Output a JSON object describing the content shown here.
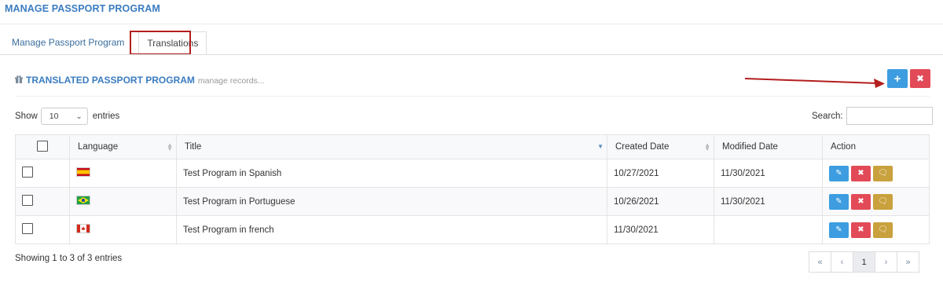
{
  "page_title": "MANAGE PASSPORT PROGRAM",
  "tabs": [
    {
      "label": "Manage Passport Program",
      "active": false
    },
    {
      "label": "Translations",
      "active": true
    }
  ],
  "section": {
    "icon": "gift-icon",
    "title": "TRANSLATED PASSPORT PROGRAM",
    "subtitle": "manage records..."
  },
  "toolbar": {
    "add_label": "+",
    "delete_label": "✖"
  },
  "length": {
    "prefix": "Show",
    "value": "10",
    "suffix": "entries"
  },
  "search": {
    "label": "Search:",
    "value": ""
  },
  "table": {
    "columns": [
      "Language",
      "Title",
      "Created Date",
      "Modified Date",
      "Action"
    ],
    "rows": [
      {
        "flag": "Spain",
        "title": "Test Program in Spanish",
        "created": "10/27/2021",
        "modified": "11/30/2021"
      },
      {
        "flag": "Brazil",
        "title": "Test Program in Portuguese",
        "created": "10/26/2021",
        "modified": "11/30/2021"
      },
      {
        "flag": "Canada",
        "title": "Test Program in french",
        "created": "11/30/2021",
        "modified": ""
      }
    ]
  },
  "footer": {
    "info": "Showing 1 to 3 of 3 entries"
  },
  "pagination": {
    "first": "«",
    "prev": "‹",
    "current": "1",
    "next": "›",
    "last": "»"
  },
  "colors": {
    "accent": "#3a7cc0",
    "add": "#3d9de0",
    "delete": "#e24a57",
    "comment": "#c9a13d",
    "highlight": "#b41e1e"
  }
}
